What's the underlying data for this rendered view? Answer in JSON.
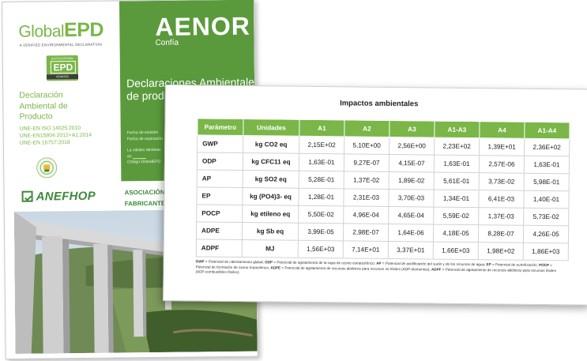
{
  "cover": {
    "brand_prefix": "Global",
    "brand_main": "EPD",
    "brand_sub": "A VERIFIED ENVIRONMENTAL DECLARATION",
    "badge_top": "ECO PLATFORM",
    "badge_main": "EPD",
    "badge_bottom": "VERIFIED",
    "declaration_lines": [
      "Declaración",
      "Ambiental de",
      "Producto"
    ],
    "norms": [
      "UNE-EN ISO 14025:2010",
      "UNE-EN15804:2012+A1:2014",
      "UNE-EN 16757:2018"
    ],
    "aenor_logo": "AENOR",
    "aenor_sub": "Confía",
    "decl_amb_lines": [
      "Declaraciones Ambientales",
      "de produ"
    ],
    "fecha_lines": [
      "Fecha de emisión",
      "Fecha de expiración"
    ],
    "validez_lines": [
      "La validez declarac",
      "en",
      "Código GlobalEPD"
    ],
    "anefhop": "ANEFHOP",
    "asoc_lines": [
      "ASOCIACIÓN N",
      "FABRICANTES"
    ],
    "accent_color": "#5a9a3c",
    "light_green": "#7ab648"
  },
  "sheet": {
    "title": "Impactos ambientales",
    "header_color": "#7ab648",
    "columns": [
      "Parámetro",
      "Unidades",
      "A1",
      "A2",
      "A3",
      "A1-A3",
      "A4",
      "A1-A4"
    ],
    "rows": [
      [
        "GWP",
        "kg CO2 eq",
        "2,15E+02",
        "5,10E+00",
        "2,56E+00",
        "2,23E+02",
        "1,39E+01",
        "2,36E+02"
      ],
      [
        "ODP",
        "kg CFC11 eq",
        "1,63E-01",
        "9,27E-07",
        "4,15E-07",
        "1,63E-01",
        "2,57E-06",
        "1,63E-01"
      ],
      [
        "AP",
        "kg SO2 eq",
        "5,28E-01",
        "1,37E-02",
        "1,89E-02",
        "5,61E-01",
        "3,73E-02",
        "5,98E-01"
      ],
      [
        "EP",
        "kg (PO4)3- eq",
        "1,28E-01",
        "2,31E-03",
        "3,70E-03",
        "1,34E-01",
        "6,41E-03",
        "1,40E-01"
      ],
      [
        "POCP",
        "kg etileno eq",
        "5,50E-02",
        "4,96E-04",
        "4,65E-04",
        "5,59E-02",
        "1,37E-03",
        "5,73E-02"
      ],
      [
        "ADPE",
        "kg Sb eq",
        "3,99E-05",
        "2,98E-07",
        "1,64E-06",
        "4,18E-05",
        "8,28E-07",
        "4,26E-05"
      ],
      [
        "ADPF",
        "MJ",
        "1,56E+03",
        "7,14E+01",
        "3,37E+01",
        "1,66E+03",
        "1,98E+02",
        "1,86E+03"
      ]
    ],
    "legend": [
      {
        "abbr": "GWP",
        "text": " = Potencial de calentamiento global; "
      },
      {
        "abbr": "ODP",
        "text": " = Potencial de agotamiento de la capa de ozono estratosférico; "
      },
      {
        "abbr": "AP",
        "text": " = Potencial de acidificación del suelo y de los recursos de agua; "
      },
      {
        "abbr": "EP",
        "text": " = Potencial de eutrofización; "
      },
      {
        "abbr": "POCP",
        "text": " = Potencial de formación de ozono troposférico; "
      },
      {
        "abbr": "ADPE",
        "text": " = Potencial de agotamiento de recursos abióticos para recursos no fósiles (ADP-elementos); "
      },
      {
        "abbr": "ADPF",
        "text": " = Potencial de agotamiento de recursos abióticos para recursos fósiles (ADP-combustibles fósiles)"
      }
    ]
  }
}
